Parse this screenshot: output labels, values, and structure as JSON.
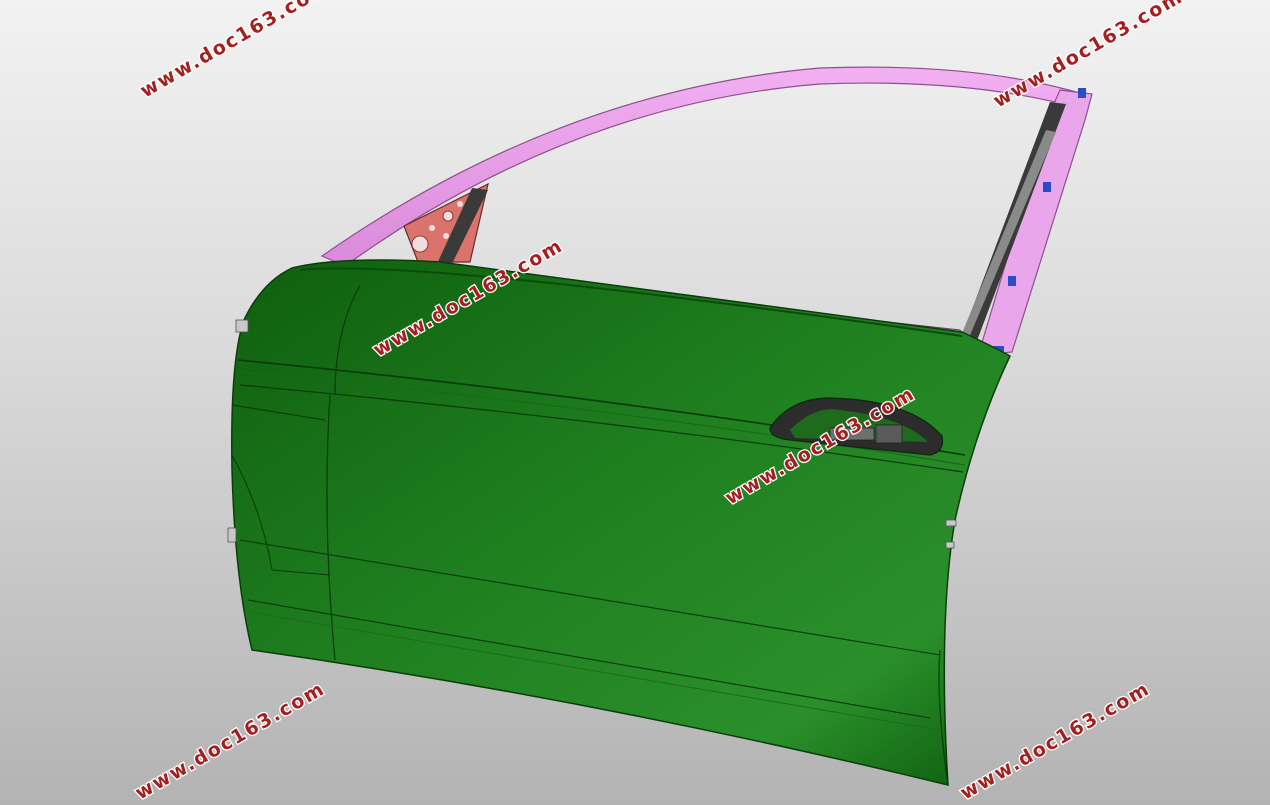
{
  "watermarks": [
    "www.doc163.com",
    "www.doc163.com",
    "www.doc163.com",
    "www.doc163.com",
    "www.doc163.com",
    "www.doc163.com",
    "www.doc163.com"
  ],
  "colors": {
    "background_top": "#f2f2f2",
    "background_bottom": "#b3b3b3",
    "door_outer_panel": "#1f7a1f",
    "window_frame": "#e58ee5",
    "mirror_bracket": "#d9736b",
    "seal": "#3a3a3a",
    "clips": "#2a4cc8",
    "watermark": "#a32020"
  }
}
